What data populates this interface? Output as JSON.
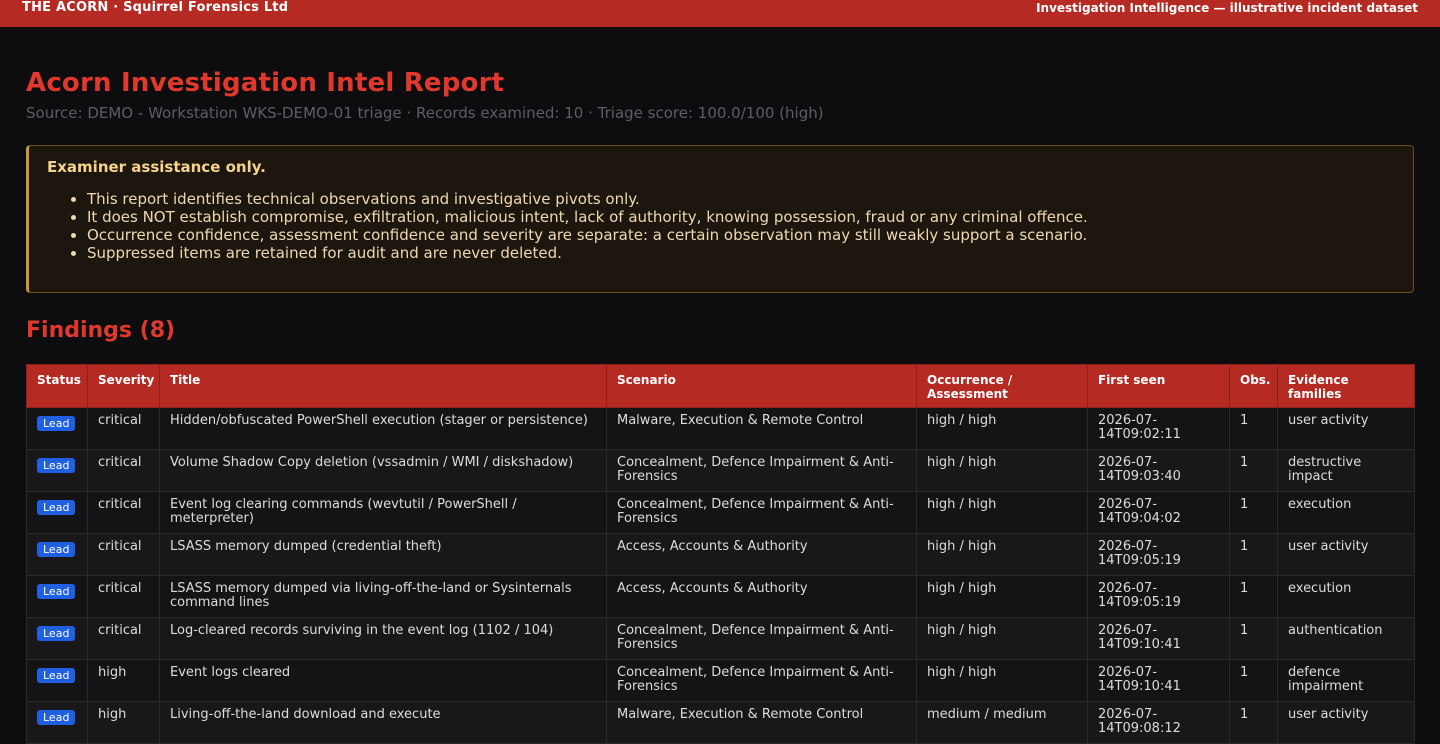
{
  "header": {
    "brand": "THE ACORN · Squirrel Forensics Ltd",
    "tagline": "Investigation Intelligence — illustrative incident dataset"
  },
  "report": {
    "title": "Acorn Investigation Intel Report",
    "subtitle": "Source: DEMO - Workstation WKS-DEMO-01 triage · Records examined: 10 · Triage score: 100.0/100 (high)"
  },
  "notice": {
    "title": "Examiner assistance only.",
    "items": [
      "This report identifies technical observations and investigative pivots only.",
      "It does NOT establish compromise, exfiltration, malicious intent, lack of authority, knowing possession, fraud or any criminal offence.",
      "Occurrence confidence, assessment confidence and severity are separate: a certain observation may still weakly support a scenario.",
      "Suppressed items are retained for audit and are never deleted."
    ]
  },
  "findings": {
    "heading": "Findings (8)",
    "columns": [
      "Status",
      "Severity",
      "Title",
      "Scenario",
      "Occurrence / Assessment",
      "First seen",
      "Obs.",
      "Evidence families"
    ],
    "rows": [
      {
        "status": "Lead",
        "severity": "critical",
        "title": "Hidden/obfuscated PowerShell execution (stager or persistence)",
        "scenario": "Malware, Execution & Remote Control",
        "confidence": "high / high",
        "first_seen": "2026-07-14T09:02:11",
        "obs": "1",
        "families": "user activity"
      },
      {
        "status": "Lead",
        "severity": "critical",
        "title": "Volume Shadow Copy deletion (vssadmin / WMI / diskshadow)",
        "scenario": "Concealment, Defence Impairment & Anti-Forensics",
        "confidence": "high / high",
        "first_seen": "2026-07-14T09:03:40",
        "obs": "1",
        "families": "destructive impact"
      },
      {
        "status": "Lead",
        "severity": "critical",
        "title": "Event log clearing commands (wevtutil / PowerShell / meterpreter)",
        "scenario": "Concealment, Defence Impairment & Anti-Forensics",
        "confidence": "high / high",
        "first_seen": "2026-07-14T09:04:02",
        "obs": "1",
        "families": "execution"
      },
      {
        "status": "Lead",
        "severity": "critical",
        "title": "LSASS memory dumped (credential theft)",
        "scenario": "Access, Accounts & Authority",
        "confidence": "high / high",
        "first_seen": "2026-07-14T09:05:19",
        "obs": "1",
        "families": "user activity"
      },
      {
        "status": "Lead",
        "severity": "critical",
        "title": "LSASS memory dumped via living-off-the-land or Sysinternals command lines",
        "scenario": "Access, Accounts & Authority",
        "confidence": "high / high",
        "first_seen": "2026-07-14T09:05:19",
        "obs": "1",
        "families": "execution"
      },
      {
        "status": "Lead",
        "severity": "critical",
        "title": "Log-cleared records surviving in the event log (1102 / 104)",
        "scenario": "Concealment, Defence Impairment & Anti-Forensics",
        "confidence": "high / high",
        "first_seen": "2026-07-14T09:10:41",
        "obs": "1",
        "families": "authentication"
      },
      {
        "status": "Lead",
        "severity": "high",
        "title": "Event logs cleared",
        "scenario": "Concealment, Defence Impairment & Anti-Forensics",
        "confidence": "high / high",
        "first_seen": "2026-07-14T09:10:41",
        "obs": "1",
        "families": "defence impairment"
      },
      {
        "status": "Lead",
        "severity": "high",
        "title": "Living-off-the-land download and execute",
        "scenario": "Malware, Execution & Remote Control",
        "confidence": "medium / medium",
        "first_seen": "2026-07-14T09:08:12",
        "obs": "1",
        "families": "user activity"
      }
    ]
  },
  "colors": {
    "accent": "#b52b24",
    "title_red": "#e0382c",
    "badge_blue": "#2060e0",
    "notice_border": "#c79a3c"
  }
}
